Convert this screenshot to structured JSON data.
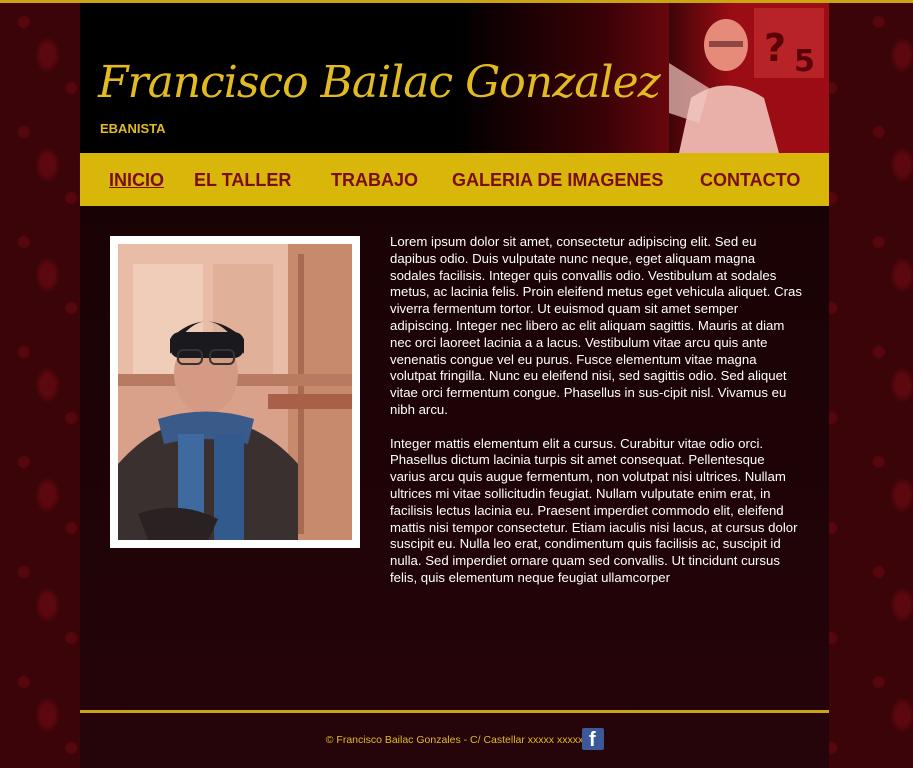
{
  "header": {
    "name": "Francisco Bailac Gonzalez",
    "subtitle": "EBANISTA"
  },
  "nav": {
    "items": [
      {
        "label": "INICIO"
      },
      {
        "label": "EL TALLER"
      },
      {
        "label": "TRABAJO"
      },
      {
        "label": "GALERIA DE IMAGENES"
      },
      {
        "label": "CONTACTO"
      }
    ]
  },
  "content": {
    "paragraph1": "Lorem ipsum dolor sit amet, consectetur adipiscing elit. Sed eu dapibus odio. Duis vulputate nunc neque, eget aliquam magna sodales facilisis. Integer quis convallis odio. Vestibulum at sodales metus, ac lacinia felis. Proin eleifend metus eget vehicula aliquet. Cras viverra fermentum tortor. Ut euismod quam sit amet semper adipiscing. Integer nec libero ac elit aliquam sagittis. Mauris at diam nec orci laoreet lacinia a a lacus. Vestibulum vitae arcu quis ante venenatis congue vel eu purus. Fusce elementum vitae magna volutpat fringilla. Nunc eu eleifend nisi, sed sagittis odio. Sed aliquet vitae orci fermentum congue. Phasellus in sus-cipit nisl. Vivamus eu nibh arcu.",
    "paragraph2": "Integer mattis elementum elit a cursus. Curabitur vitae odio orci. Phasellus dictum lacinia turpis sit amet consequat. Pellentesque varius arcu quis augue fermentum, non volutpat nisi ultrices. Nullam ultrices mi vitae sollicitudin feugiat. Nullam vulputate enim erat, in facilisis lectus lacinia eu. Praesent imperdiet commodo elit, eleifend mattis nisi tempor consectetur. Etiam iaculis nisi lacus, at cursus dolor suscipit eu. Nulla leo erat, condimentum quis facilisis ac, suscipit id nulla. Sed imperdiet ornare quam sed convallis. Ut tincidunt cursus felis, quis elementum neque feugiat ullamcorper"
  },
  "footer": {
    "text": "© Francisco Bailac Gonzales - C/ Castellar xxxxx xxxxx",
    "social_icon": "facebook-icon"
  },
  "colors": {
    "accent_gold": "#d8b60a",
    "nav_text": "#7a0d12",
    "background": "#3a0408"
  }
}
